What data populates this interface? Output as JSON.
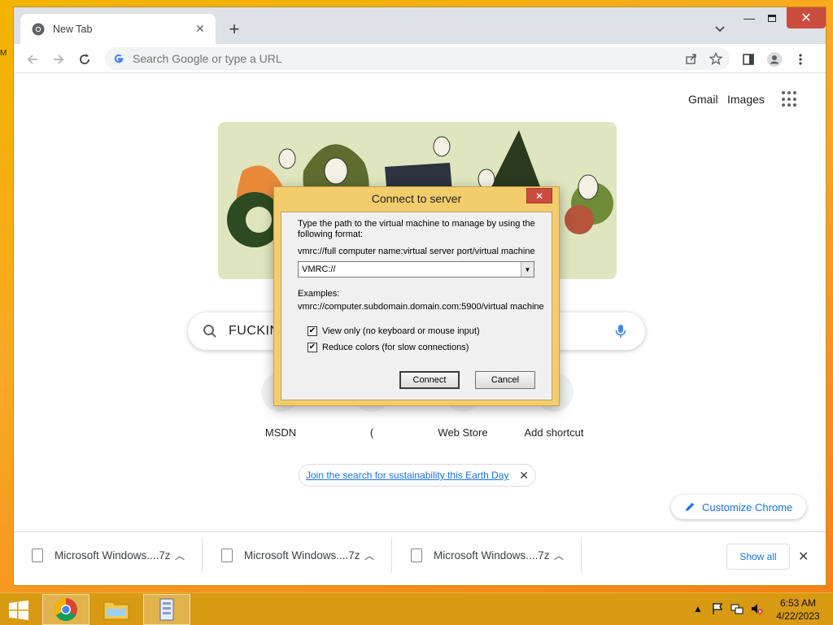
{
  "desktop": {
    "stray_text": "M"
  },
  "browser": {
    "tab_title": "New Tab",
    "new_tab": "+",
    "omnibox_placeholder": "Search Google or type a URL"
  },
  "ntp": {
    "top_links": [
      "Gmail",
      "Images"
    ],
    "search_value": "FUCKIN",
    "shortcuts": [
      "MSDN",
      "(",
      "Web Store",
      "Add shortcut"
    ],
    "promo_text": "Join the search for sustainability this Earth Day",
    "customize_label": "Customize Chrome"
  },
  "downloads": {
    "items": [
      "Microsoft Windows....7z",
      "Microsoft Windows....7z",
      "Microsoft Windows....7z"
    ],
    "show_all": "Show all"
  },
  "dialog": {
    "title": "Connect to server",
    "description": "Type the path to the virtual machine to manage by using the following format:",
    "format": "vmrc://full computer name:virtual server port/virtual machine",
    "input_value": "VMRC://",
    "examples_label": "Examples:",
    "example": "vmrc://computer.subdomain.domain.com:5900/virtual machine",
    "checkbox_view_only": "View only (no keyboard or mouse input)",
    "checkbox_reduce_colors": "Reduce colors (for slow connections)",
    "view_only_checked": true,
    "reduce_colors_checked": true,
    "connect_label": "Connect",
    "cancel_label": "Cancel"
  },
  "taskbar": {
    "time": "6:53 AM",
    "date": "4/22/2023"
  },
  "colors": {
    "desktop": "#f4b400",
    "taskbar": "#d79a12",
    "dialog_frame": "#f3cc6c",
    "close_red": "#c94c3f",
    "link_blue": "#1a73e8"
  }
}
